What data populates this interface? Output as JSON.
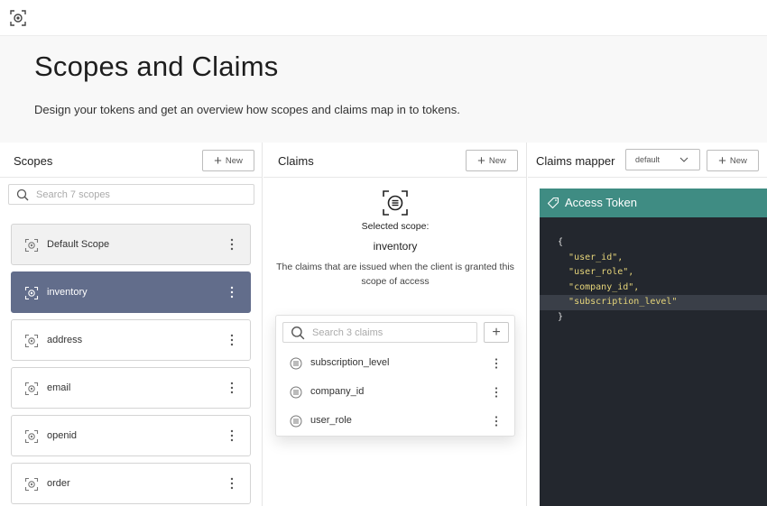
{
  "page": {
    "title": "Scopes and Claims",
    "subtitle": "Design your tokens and get an overview how scopes and claims map in to tokens."
  },
  "icons": {
    "logo": "scope-logo-icon",
    "search": "search-icon",
    "scope": "scope-icon",
    "claim": "claim-list-icon",
    "more": "more-vertical-icon",
    "tag": "tag-icon",
    "chevron": "chevron-down-icon"
  },
  "colors": {
    "selected_scope": "#626d8b",
    "token_header": "#3f8c83",
    "token_body": "#23272e",
    "code_string": "#e6d57a"
  },
  "scopes": {
    "title": "Scopes",
    "new_label": "New",
    "search_placeholder": "Search 7 scopes",
    "items": [
      {
        "label": "Default Scope",
        "state": "default"
      },
      {
        "label": "inventory",
        "state": "selected"
      },
      {
        "label": "address",
        "state": "normal"
      },
      {
        "label": "email",
        "state": "normal"
      },
      {
        "label": "openid",
        "state": "normal"
      },
      {
        "label": "order",
        "state": "normal"
      }
    ]
  },
  "claims": {
    "title": "Claims",
    "new_label": "New",
    "selected_label": "Selected scope:",
    "selected_name": "inventory",
    "description": "The claims that are issued when the client is granted this scope of access",
    "search_placeholder": "Search 3 claims",
    "add_label": "+",
    "items": [
      {
        "label": "subscription_level"
      },
      {
        "label": "company_id"
      },
      {
        "label": "user_role"
      }
    ]
  },
  "mapper": {
    "title": "Claims mapper",
    "dropdown_value": "default",
    "new_label": "New",
    "token_title": "Access Token",
    "code": {
      "open": "{",
      "lines": [
        "\"user_id\",",
        "\"user_role\",",
        "\"company_id\",",
        "\"subscription_level\""
      ],
      "close": "}"
    }
  }
}
